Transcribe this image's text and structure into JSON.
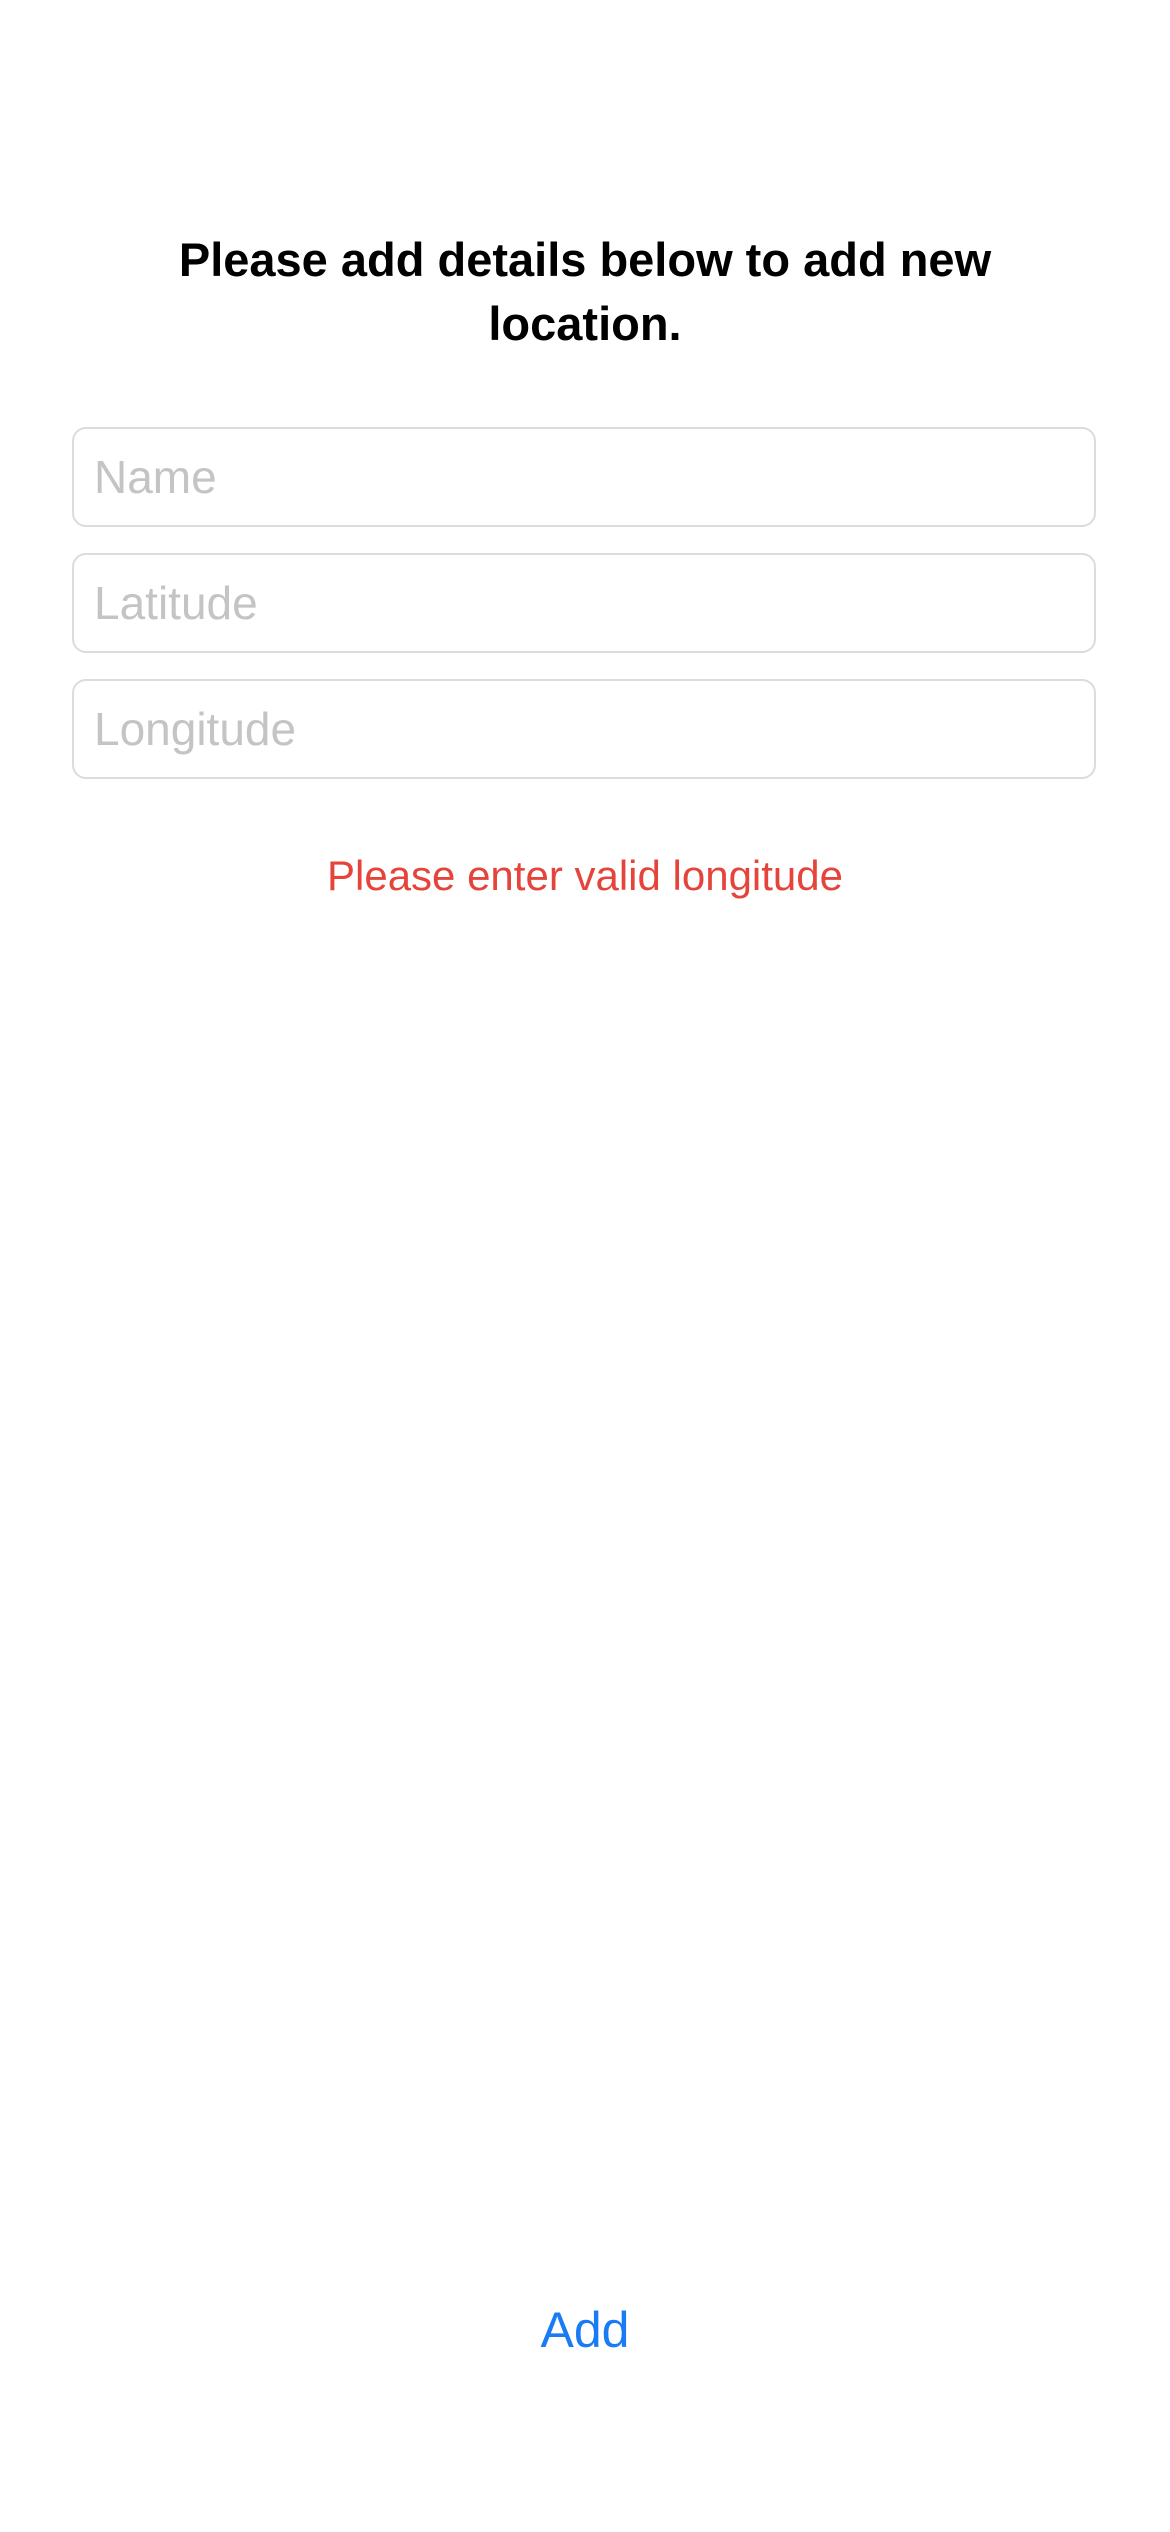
{
  "form": {
    "instructions": "Please add details below to add new location.",
    "fields": {
      "name": {
        "value": "",
        "placeholder": "Name"
      },
      "latitude": {
        "value": "",
        "placeholder": "Latitude"
      },
      "longitude": {
        "value": "",
        "placeholder": "Longitude"
      }
    },
    "error_message": "Please enter valid longitude",
    "add_label": "Add"
  },
  "colors": {
    "background": "#ffffff",
    "text": "#000000",
    "error": "#e5443b",
    "accent": "#1a7cf4",
    "placeholder": "#c4c4c6",
    "field_border": "#dcdcdc"
  }
}
